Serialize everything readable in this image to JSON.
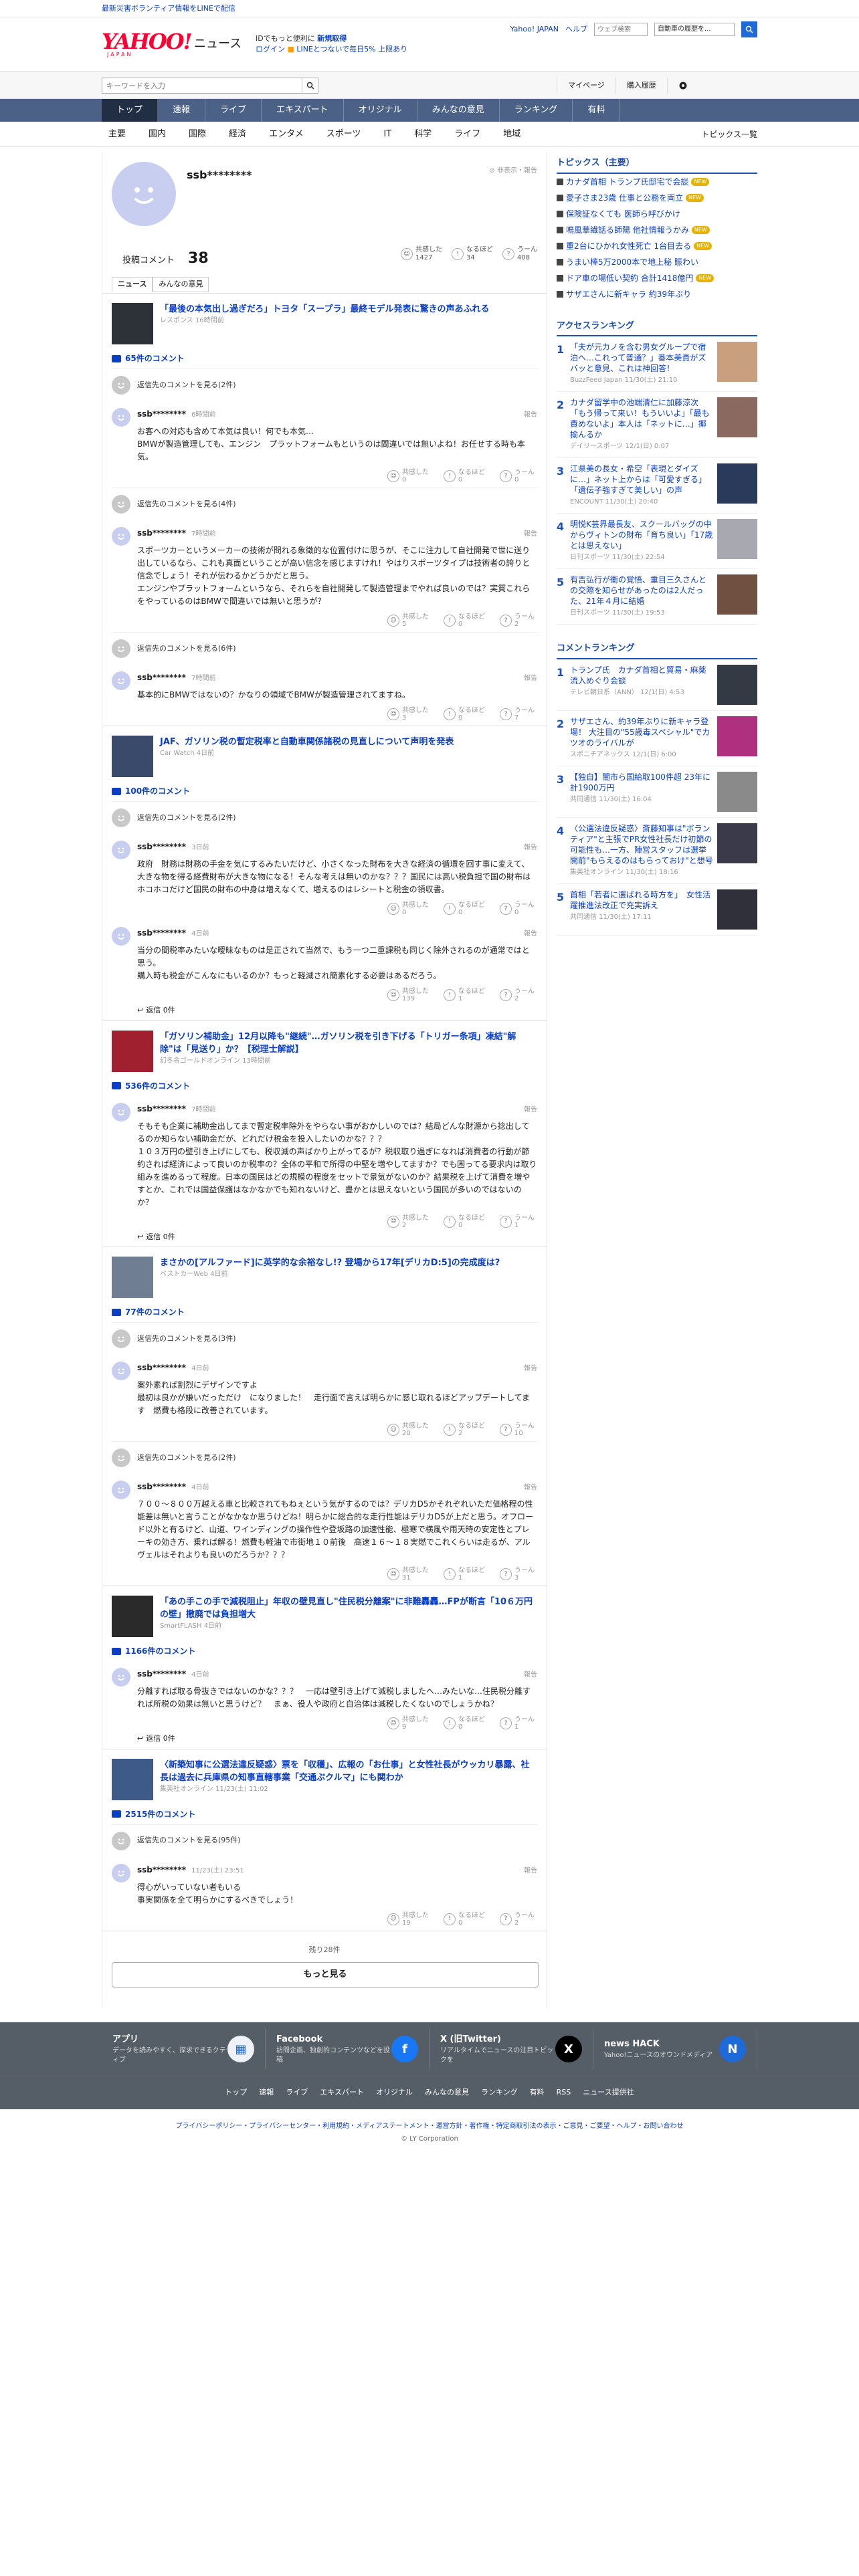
{
  "topbar": {
    "notice": "最新災害ボランティア情報をLINEで配信"
  },
  "header": {
    "logo_text": "YAHOO!",
    "logo_sub": "JAPAN",
    "logo_news": "ニュース",
    "promo_l1a": "ID",
    "promo_l1b": "でもっと便利に",
    "promo_l1c": "新規取得",
    "promo_l2a": "ログイン",
    "promo_l2b": "LINEとつないで毎日5%",
    "promo_l2c": "上限あり",
    "links": [
      "Yahoo! JAPAN",
      "ヘルプ"
    ],
    "search_placeholder": "ウェブ検索",
    "search_scope": "自動車の履歴を...",
    "brand_red": "#ff0033",
    "brand_blue": "#1d6ad8"
  },
  "searchbar": {
    "placeholder": "キーワードを入力",
    "mypage": "マイページ",
    "history": "購入履歴"
  },
  "nav": {
    "tabs": [
      "トップ",
      "速報",
      "ライブ",
      "エキスパート",
      "オリジナル",
      "みんなの意見",
      "ランキング",
      "有料"
    ]
  },
  "subnav": {
    "items": [
      "主要",
      "国内",
      "国際",
      "経済",
      "エンタメ",
      "スポーツ",
      "IT",
      "科学",
      "ライフ",
      "地域"
    ],
    "topics": "トピックス一覧"
  },
  "profile": {
    "name": "ssb********",
    "links": "非表示・報告",
    "comments_label": "投稿コメント",
    "comments_count": "38",
    "reacts": [
      {
        "label": "共感した",
        "count": "1427"
      },
      {
        "label": "なるほど",
        "count": "34"
      },
      {
        "label": "うーん",
        "count": "408"
      }
    ],
    "tabs": [
      "ニュース",
      "みんなの意見"
    ]
  },
  "labels": {
    "view_parent": "返信先のコメントを見る",
    "report": "報告",
    "reply": "返信",
    "empathy": "共感した",
    "indeed": "なるほど",
    "hmm": "うーん"
  },
  "articles": [
    {
      "title": "「最後の本気出し過ぎだろ」トヨタ「スープラ」最終モデル発表に驚きの声あふれる",
      "meta": "レスポンス 16時間前",
      "comment_count": "65件のコメント",
      "thumb_color": "#2c3238",
      "comments": [
        {
          "parent": "返信先のコメントを見る(2件)",
          "name": "ssb********",
          "time": "6時間前",
          "text": "お客への対応も含めて本気は良い！何でも本気…\nBMWが製造管理しても、エンジン　プラットフォームもというのは間違いでは無いよね！お任せする時も本気。",
          "r1": "0",
          "r2": "0",
          "r3": "0",
          "replies": ""
        },
        {
          "parent": "返信先のコメントを見る(4件)",
          "name": "ssb********",
          "time": "7時間前",
          "text": "スポーツカーというメーカーの技術が問れる象徴的な位置付けに思うが、そこに注力して自社開発で世に送り出しているなら、これも真面ということが高い信念を感じますけれ！やはりスポーツタイプは技術者の誇りと信念でしょう！それが伝わるかどうかだと思う。\nエンジンやプラットフォームというなら、それらを自社開発して製造管理までやれば良いのでは？実質これらをやっているのはBMWで間違いでは無いと思うが？",
          "r1": "5",
          "r2": "0",
          "r3": "2",
          "replies": ""
        },
        {
          "parent": "返信先のコメントを見る(6件)",
          "name": "ssb********",
          "time": "7時間前",
          "text": "基本的にBMWではないの？かなりの領域でBMWが製造管理されてますね。",
          "r1": "3",
          "r2": "0",
          "r3": "7",
          "replies": ""
        }
      ]
    },
    {
      "title": "JAF、ガソリン税の暫定税率と自動車関係諸税の見直しについて声明を発表",
      "meta": "Car Watch 4日前",
      "comment_count": "100件のコメント",
      "thumb_color": "#3a4a6a",
      "comments": [
        {
          "parent": "返信先のコメントを見る(2件)",
          "name": "ssb********",
          "time": "3日前",
          "text": "政府　財務は財務の手金を気にするみたいだけど、小さくなった財布を大きな経済の循環を回す事に変えて、大きな物を得る経費財布が大きな物になる！そんな考えは無いのかな？？？国民には高い税負担で国の財布はホコホコだけど国民の財布の中身は増えなくて、増えるのはレシートと税金の領収書。",
          "r1": "0",
          "r2": "0",
          "r3": "0",
          "replies": ""
        },
        {
          "parent": "",
          "name": "ssb********",
          "time": "4日前",
          "text": "当分の間税率みたいな曖昧なものは是正されて当然で、もう一つ二重課税も同じく除外されるのが通常ではと思う。\n購入時も税金がこんなにもいるのか？もっと軽減され簡素化する必要はあるだろう。",
          "r1": "139",
          "r2": "1",
          "r3": "2",
          "replies": "返信 0件"
        }
      ]
    },
    {
      "title": "「ガソリン補助金」12月以降も\"継続\"…ガソリン税を引き下げる「トリガー条項」凍結\"解除\"は「見送り」か？【税理士解説】",
      "meta": "幻冬舎ゴールドオンライン 13時間前",
      "comment_count": "536件のコメント",
      "thumb_color": "#a02030",
      "comments": [
        {
          "parent": "",
          "name": "ssb********",
          "time": "7時間前",
          "text": "そもそも企業に補助金出してまで暫定税率除外をやらない事がおかしいのでは？結局どんな財源から捻出してるのか知らない補助金だが、どれだけ税金を投入したいのかな？？？\n１０３万円の壁引き上げにしても、税収減の声ばかり上がってるが？税収取り過ぎになれば消費者の行動が節約されば経済によって良いのか税率の？全体の平和で所得の中堅を増やしてますか？でも困ってる要求内は取り組みを進めるって程度。日本の国民はどの規模の程度をセットで景気がないのか？結果税を上げて消費を増やすとか、これでは国益保護はなかなかでも知れないけど、豊かとは思えないという国民が多いのではないのか？",
          "r1": "2",
          "r2": "0",
          "r3": "1",
          "replies": "返信 0件"
        }
      ]
    },
    {
      "title": "まさかの[アルファード]に英学的な余裕なし!? 登場から17年[デリカD:5]の完成度は?",
      "meta": "ベストカーWeb 4日前",
      "comment_count": "77件のコメント",
      "thumb_color": "#6f7e92",
      "comments": [
        {
          "parent": "返信先のコメントを見る(3件)",
          "name": "ssb********",
          "time": "4日前",
          "text": "案外素れば割烈にデザインですよ\n最初は良かが嫌いだっただけ　になりました！　走行面で言えば明らかに感じ取れるほどアップデートしてます　燃費も格段に改善されています。",
          "r1": "20",
          "r2": "2",
          "r3": "10",
          "replies": ""
        },
        {
          "parent": "返信先のコメントを見る(2件)",
          "name": "ssb********",
          "time": "4日前",
          "text": "７００〜８００万越える車と比較されてもねぇという気がするのでは？デリカD5かそれぞれいただ価格程の性能差は無いと言うことがなかなか思うけどね！明らかに総合的な走行性能はデリカD5が上だと思う。オフロード以外と有るけど、山道、ワインディングの操作性や登坂路の加速性能、極寒で横風や雨天時の安定性とプレーキの効き方、乗れば解る！燃費も軽油で市街地１０前後　高速１６〜１８実燃でこれくらいは走るが、アルヴェルはそれよりも良いのだろうか？？？",
          "r1": "31",
          "r2": "1",
          "r3": "3",
          "replies": ""
        }
      ]
    },
    {
      "title": "「あの手この手で減税阻止」年収の壁見直し\"住民税分離案\"に非難轟轟…FPが断言「10６万円の壁」撤廃では負担増大",
      "meta": "SmartFLASH 4日前",
      "comment_count": "1166件のコメント",
      "thumb_color": "#2a2a2a",
      "comments": [
        {
          "parent": "",
          "name": "ssb********",
          "time": "4日前",
          "text": "分離すれば取る骨抜きではないのかな？？？　一応は壁引き上げて減税しましたへ…みたいな…住民税分離すれば所税の効果は無いと思うけど？　まぁ、役人や政府と自治体は減税したくないのでしょうかね？",
          "r1": "9",
          "r2": "0",
          "r3": "1",
          "replies": "返信 0件"
        }
      ]
    },
    {
      "title": "〈新築知事に公選法違反疑惑〉票を「収穫」、広報の「お仕事」と女性社長がウッカリ暴露、社長は過去に兵庫県の知事直轄事業「交通ぷクルマ」にも関わか",
      "meta": "集英社オンライン 11/23(土) 11:02",
      "comment_count": "2515件のコメント",
      "thumb_color": "#3d5a88",
      "comments": [
        {
          "parent": "返信先のコメントを見る(95件)",
          "name": "ssb********",
          "time": "11/23(土) 23:51",
          "text": "得心がいっていない者もいる\n事実関係を全て明らかにするべきでしょう！",
          "r1": "19",
          "r2": "0",
          "r3": "2",
          "replies": ""
        }
      ]
    }
  ],
  "more": {
    "remaining": "残り28件",
    "button": "もっと見る"
  },
  "sidebar": {
    "topics_title": "トピックス（主要）",
    "topics": [
      {
        "text": "カナダ首相 トランプ氏邸宅で会談",
        "badge": "NEW"
      },
      {
        "text": "愛子さま23歳 仕事と公務を両立",
        "badge": "NEW"
      },
      {
        "text": "保険証なくても 医師ら呼びかけ",
        "badge": ""
      },
      {
        "text": "鳴風華繊話る師陽 他社情報うかみ",
        "badge": "NEW"
      },
      {
        "text": "重2台にひかれ女性死亡 1台目去る",
        "badge": "NEW"
      },
      {
        "text": "うまい棒5万2000本で地上秘 賑わい",
        "badge": ""
      },
      {
        "text": "ドア車の場低い契約 合計1418億円",
        "badge": "NEW"
      },
      {
        "text": "サザエさんに新キャラ 約39年ぶり",
        "badge": ""
      }
    ],
    "access_title": "アクセスランキング",
    "access": [
      {
        "n": "1",
        "text": "「夫が元カノを含む男女グループで宿泊へ…これって普通？」番本美貴がズバッと意見、これは神回答！",
        "src": "BuzzFeed Japan 11/30(土) 21:10",
        "color": "#c8a080"
      },
      {
        "n": "2",
        "text": "カナダ留学中の池端清仁に加藤涼次「もう帰って来い！もういいよ」「最も責めないよ」本人は「ネットに…」揶揄んるか",
        "src": "デイリースポーツ 12/1(日) 0:07",
        "color": "#8a6a60"
      },
      {
        "n": "3",
        "text": "江県美の長女・希空「表現とダイズに…」ネット上からは「可愛すぎる」「遺伝子強すぎて美しい」の声",
        "src": "ENCOUNT 11/30(土) 20:40",
        "color": "#2a3a5a"
      },
      {
        "n": "4",
        "text": "明悦K芸界最長友、スクールバッグの中からヴィトンの財布「育ち良い」「17歳とは思えない」",
        "src": "日刊スポーツ 11/30(土) 22:54",
        "color": "#a8a8b0"
      },
      {
        "n": "5",
        "text": "有吉弘行が衝の覚悟、重目三久さんとの交際を知らせがあったのは2人だった、21年４月に結婚",
        "src": "日刊スポーツ 11/30(土) 19:53",
        "color": "#705040"
      }
    ],
    "comment_title": "コメントランキング",
    "comment_rank": [
      {
        "n": "1",
        "text": "トランプ氏　カナダ首相と貿易・麻薬流入めぐり会談",
        "src": "テレビ朝日系（ANN） 12/1(日) 4:53",
        "color": "#333a44"
      },
      {
        "n": "2",
        "text": "サザエさん、約39年ぶりに新キャラ登場！ 大注目の\"55歳毒スペシャル\"でカツオのライバルが",
        "src": "スポニチアネックス 12/1(日) 6:00",
        "color": "#b03080"
      },
      {
        "n": "3",
        "text": "【独自】闇市ら国給取100件超 23年に計1900万円",
        "src": "共同通信 11/30(土) 16:04",
        "color": "#8a8a8a"
      },
      {
        "n": "4",
        "text": "〈公選法違反疑惑〉斎藤知事は\"ボランティア\"と主張でPR女性社長だけ初節の可能性も…一方、陣営スタッフは選挙開前\"もらえるのはもらっておけ\"と想号",
        "src": "集英社オンライン 11/30(土) 18:16",
        "color": "#3a3a4a"
      },
      {
        "n": "5",
        "text": "首相「若者に選ばれる時方を」　女性活躍推進法改正で充実訴え",
        "src": "共同通信 11/30(土) 17:11",
        "color": "#30303a"
      }
    ]
  },
  "footer": {
    "apps": [
      {
        "title": "アプリ",
        "desc": "データを読みやすく、探求できるクティブ",
        "icon_color": "#eef2f8"
      },
      {
        "title": "Facebook",
        "desc": "訪問企画、独創的コンテンツなどを投稿",
        "icon_color": "#1877f2"
      },
      {
        "title": "X (旧Twitter)",
        "desc": "リアルタイムでニュースの注目トピックを",
        "icon_color": "#000000"
      },
      {
        "title": "news HACK",
        "desc": "Yahoo!ニュースのオウンドメディア",
        "icon_color": "#1d6ad8"
      }
    ],
    "nav": [
      "トップ",
      "速報",
      "ライブ",
      "エキスパート",
      "オリジナル",
      "みんなの意見",
      "ランキング",
      "有料",
      "RSS",
      "ニュース提供社"
    ],
    "legal": "プライバシーポリシー・プライバシーセンター・利用規約・メディアステートメント・運営方針・著作権・特定商取引法の表示・ご意見・ご要望・ヘルプ・お問い合わせ",
    "copyright": "© LY Corporation"
  }
}
